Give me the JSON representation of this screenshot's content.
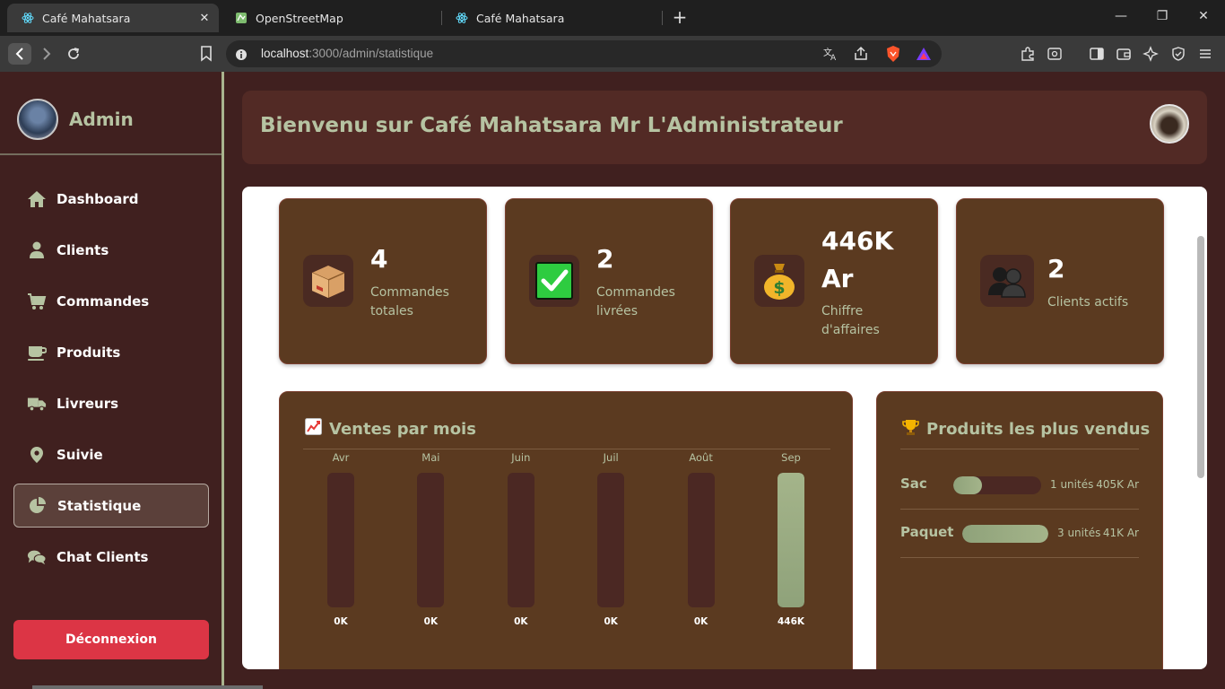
{
  "browser": {
    "tabs": [
      {
        "title": "Café Mahatsara",
        "icon": "react-icon",
        "active": true
      },
      {
        "title": "OpenStreetMap",
        "icon": "openstreetmap-icon",
        "active": false
      },
      {
        "title": "Café Mahatsara",
        "icon": "react-icon",
        "active": false
      }
    ],
    "url_host": "localhost",
    "url_path": ":3000/admin/statistique"
  },
  "sidebar": {
    "admin_name": "Admin",
    "items": [
      {
        "label": "Dashboard",
        "icon": "home-icon"
      },
      {
        "label": "Clients",
        "icon": "user-icon"
      },
      {
        "label": "Commandes",
        "icon": "cart-icon"
      },
      {
        "label": "Produits",
        "icon": "coffee-cup-icon"
      },
      {
        "label": "Livreurs",
        "icon": "truck-icon"
      },
      {
        "label": "Suivie",
        "icon": "map-pin-icon"
      },
      {
        "label": "Statistique",
        "icon": "pie-chart-icon",
        "active": true
      },
      {
        "label": "Chat Clients",
        "icon": "chat-icon"
      }
    ],
    "logout_label": "Déconnexion"
  },
  "header": {
    "title": "Bienvenu sur Café Mahatsara Mr L'Administrateur"
  },
  "stats": [
    {
      "value": "4",
      "label_line1": "Commandes",
      "label_line2": "totales",
      "icon": "package-emoji-icon"
    },
    {
      "value": "2",
      "label_line1": "Commandes",
      "label_line2": "livrées",
      "icon": "check-mark-emoji-icon"
    },
    {
      "value_line1": "446K",
      "value_line2": "Ar",
      "label_line1": "Chiffre",
      "label_line2": "d'affaires",
      "icon": "money-bag-emoji-icon"
    },
    {
      "value": "2",
      "label_line1": "Clients actifs",
      "icon": "busts-emoji-icon"
    }
  ],
  "sales_panel": {
    "title": "Ventes par mois",
    "icon": "chart-increasing-emoji-icon"
  },
  "chart_data": {
    "type": "bar",
    "title": "Ventes par mois",
    "categories": [
      "Avr",
      "Mai",
      "Juin",
      "Juil",
      "Août",
      "Sep"
    ],
    "values": [
      0,
      0,
      0,
      0,
      0,
      446
    ],
    "value_labels": [
      "0K",
      "0K",
      "0K",
      "0K",
      "0K",
      "446K"
    ],
    "unit": "K",
    "ylim": [
      0,
      446
    ],
    "colors": {
      "fill": "#a4b48a",
      "track": "#4b2823"
    }
  },
  "top_products": {
    "title": "Produits les plus vendus",
    "icon": "trophy-emoji-icon",
    "items": [
      {
        "name": "Sac",
        "fraction": 0.33,
        "units_text": "1 unités",
        "amount_text": "405K Ar"
      },
      {
        "name": "Paquet",
        "fraction": 1.0,
        "units_text": "3 unités",
        "amount_text": "41K Ar"
      }
    ]
  },
  "colors": {
    "sidebar_bg": "#40201f",
    "accent_green": "#b6c3a2",
    "card_bg": "#5b3a20",
    "logout_red": "#dc3545"
  }
}
